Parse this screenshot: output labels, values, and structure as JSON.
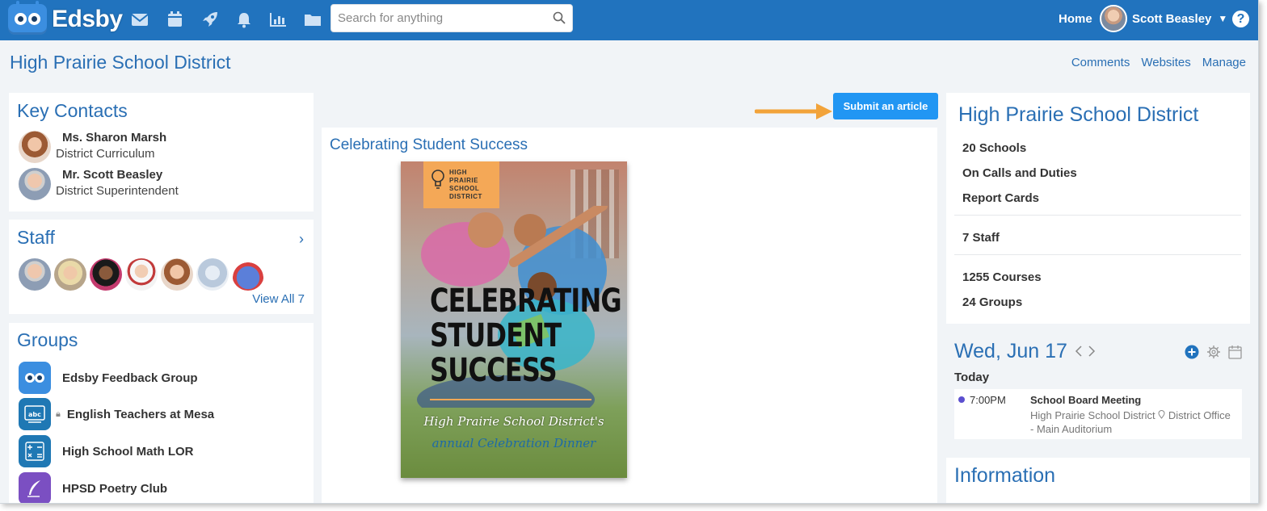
{
  "app": {
    "logo_text": "Edsby",
    "brand_color": "#2173be"
  },
  "topbar": {
    "icons": [
      "mail-icon",
      "calendar-icon",
      "rocket-icon",
      "bell-icon",
      "chart-icon",
      "folder-icon"
    ],
    "search": {
      "placeholder": "Search for anything",
      "value": ""
    },
    "home_label": "Home",
    "user_name": "Scott Beasley",
    "help_label": "?"
  },
  "page": {
    "title": "High Prairie School District",
    "links": [
      "Comments",
      "Websites",
      "Manage"
    ]
  },
  "key_contacts": {
    "title": "Key Contacts",
    "contacts": [
      {
        "name": "Ms. Sharon Marsh",
        "role": "District Curriculum"
      },
      {
        "name": "Mr. Scott Beasley",
        "role": "District Superintendent"
      }
    ]
  },
  "staff": {
    "title": "Staff",
    "view_all": "View All 7",
    "chevron": "›"
  },
  "groups": {
    "title": "Groups",
    "items": [
      {
        "label": "Edsby Feedback Group",
        "icon": "edsby-robot-icon",
        "color": "#3b8ee0"
      },
      {
        "label": "English Teachers at Mesa",
        "icon": "abc-board-icon",
        "color": "#1f78b4",
        "locked": true
      },
      {
        "label": "High School Math LOR",
        "icon": "math-symbols-icon",
        "color": "#1f78b4"
      },
      {
        "label": "HPSD Poetry Club",
        "icon": "quill-icon",
        "color": "#7b4fc2"
      }
    ]
  },
  "feed": {
    "submit_label": "Submit an article",
    "article_title": "Celebrating Student Success",
    "poster": {
      "badge_lines": [
        "HIGH",
        "PRAIRIE",
        "SCHOOL",
        "DISTRICT"
      ],
      "headline": [
        "CELEBRATING",
        "STUDENT",
        "SUCCESS"
      ],
      "subtitle_1": "High Prairie School District's",
      "subtitle_2": "annual Celebration Dinner",
      "accent": "#f4a857"
    }
  },
  "district_panel": {
    "title": "High Prairie School District",
    "items": [
      "20 Schools",
      "On Calls and Duties",
      "Report Cards",
      "7 Staff",
      "1255 Courses",
      "24 Groups"
    ]
  },
  "calendar": {
    "date_label": "Wed, Jun 17",
    "today_label": "Today",
    "events": [
      {
        "time": "7:00PM",
        "title": "School Board Meeting",
        "location": "High Prairie School District",
        "location_detail": "District Office - Main Auditorium"
      }
    ]
  },
  "information": {
    "title": "Information"
  }
}
